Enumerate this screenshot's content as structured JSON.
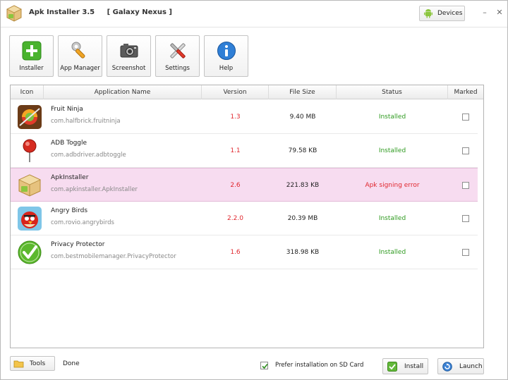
{
  "window": {
    "app_name": "Apk Installer 3.5",
    "device": "[ Galaxy Nexus ]",
    "devices_button": "Devices",
    "minimize": "–",
    "close": "✕"
  },
  "toolbar": {
    "items": [
      {
        "label": "Installer",
        "icon": "installer-icon"
      },
      {
        "label": "App Manager",
        "icon": "app-manager-icon"
      },
      {
        "label": "Screenshot",
        "icon": "camera-icon"
      },
      {
        "label": "Settings",
        "icon": "settings-icon"
      },
      {
        "label": "Help",
        "icon": "help-icon"
      }
    ]
  },
  "table": {
    "columns": [
      "Icon",
      "Application Name",
      "Version",
      "File Size",
      "Status",
      "Marked"
    ],
    "rows": [
      {
        "icon": "fruit-ninja-icon",
        "name": "Fruit Ninja",
        "package": "com.halfbrick.fruitninja",
        "version": "1.3",
        "size": "9.40 MB",
        "status": "Installed",
        "status_kind": "ok",
        "marked": false
      },
      {
        "icon": "pin-icon",
        "name": "ADB Toggle",
        "package": "com.adbdriver.adbtoggle",
        "version": "1.1",
        "size": "79.58 KB",
        "status": "Installed",
        "status_kind": "ok",
        "marked": false
      },
      {
        "icon": "apk-box-icon",
        "name": "ApkInstaller",
        "package": "com.apkinstaller.ApkInstaller",
        "version": "2.6",
        "size": "221.83 KB",
        "status": "Apk signing error",
        "status_kind": "error",
        "marked": false,
        "selected": true
      },
      {
        "icon": "angry-birds-icon",
        "name": "Angry Birds",
        "package": "com.rovio.angrybirds",
        "version": "2.2.0",
        "size": "20.39 MB",
        "status": "Installed",
        "status_kind": "ok",
        "marked": false
      },
      {
        "icon": "checkmark-icon",
        "name": "Privacy Protector",
        "package": "com.bestmobilemanager.PrivacyProtector",
        "version": "1.6",
        "size": "318.98 KB",
        "status": "Installed",
        "status_kind": "ok",
        "marked": false
      }
    ]
  },
  "footer": {
    "tools_button": "Tools",
    "status": "Done",
    "sd_card_label": "Prefer installation on SD Card",
    "sd_card_checked": true,
    "install_button": "Install",
    "launch_button": "Launch"
  },
  "colors": {
    "selected_row": "#f7dcf0",
    "installed": "#2e9a1f",
    "error": "#e0262d",
    "version": "#e0262d"
  }
}
